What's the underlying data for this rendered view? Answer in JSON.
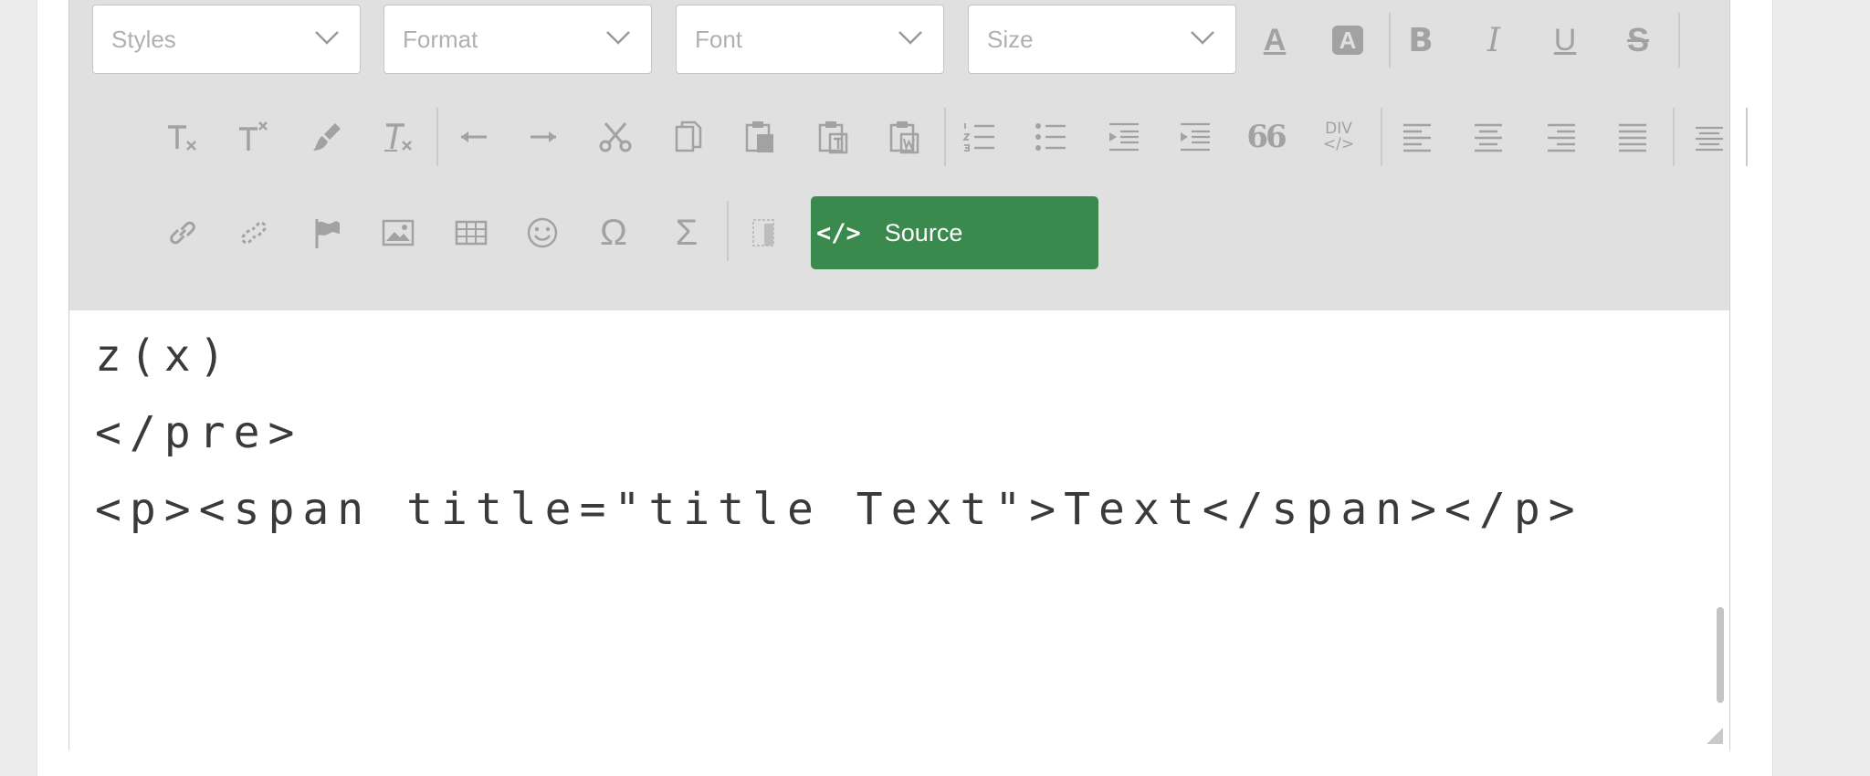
{
  "toolbar": {
    "combos": {
      "styles": "Styles",
      "format": "Format",
      "font": "Font",
      "size": "Size"
    },
    "glyphs": {
      "text_color": "A",
      "bg_color": "A",
      "bold": "B",
      "italic": "I",
      "underline": "U",
      "strike": "S",
      "quote": "66",
      "div_top": "DIV",
      "div_bottom": "</>",
      "omega": "Ω",
      "sigma": "Σ"
    },
    "source": {
      "icon_text": "</>",
      "label": "Source"
    }
  },
  "content": {
    "lines": [
      "z(x)",
      "</pre>",
      "<p><span title=\"title Text\">Text</span></p>"
    ]
  },
  "colors": {
    "toolbar_bg": "#e0e0e0",
    "source_button": "#3a8a4e",
    "icon": "#a2a2a2"
  }
}
